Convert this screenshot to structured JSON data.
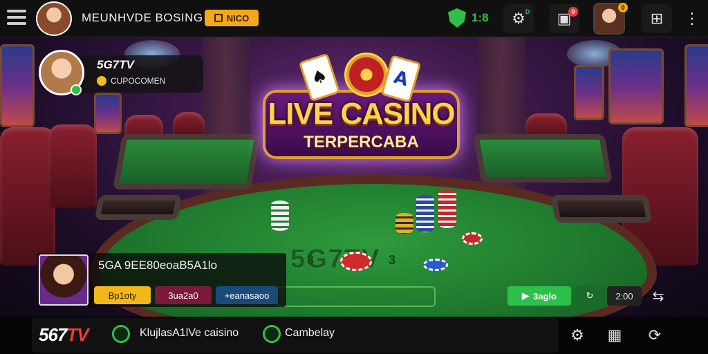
{
  "topbar": {
    "app_title": "MEUNHVDE BOSING",
    "promo_label": "NICO",
    "status_value": "1:8",
    "settings_badge": "D",
    "wallet_badge": "0",
    "profile_badge": "0"
  },
  "host": {
    "name": "5G7TV",
    "status": "CUPOCOMEN"
  },
  "hero": {
    "title": "LIVE CASINO",
    "subtitle": "TERPERCABA",
    "card_left": "♠",
    "card_right": "A"
  },
  "table": {
    "logo": "5G7TV",
    "numbers": [
      "8",
      "3",
      "3"
    ]
  },
  "dealer": {
    "name": "5GA 9EE80eoaB5A1lo",
    "buttons": [
      {
        "label": "Bp1oty",
        "color": "#f2b81a",
        "text": "#2a1800"
      },
      {
        "label": "3ua2a0",
        "color": "#7a1a3a",
        "text": "#ffffff"
      },
      {
        "label": "+eanasaoo",
        "color": "#1a4a7a",
        "text": "#ffffff"
      }
    ]
  },
  "controls": {
    "play_label": "3aglo",
    "timer_value": "2:00"
  },
  "bottombar": {
    "brand_main": "567",
    "brand_accent": "TV",
    "nav_label": "KlujlasА1lVe caisino",
    "community_label": "Cambelay"
  },
  "colors": {
    "accent_green": "#2ec04a",
    "accent_gold": "#f2a81a",
    "brand_red": "#f23a3a"
  },
  "icons": [
    "menu-icon",
    "shield-icon",
    "gear-icon",
    "wallet-icon",
    "grid-icon",
    "more-icon",
    "refresh-icon",
    "chat-icon",
    "settings-icon",
    "arrow-icon"
  ]
}
